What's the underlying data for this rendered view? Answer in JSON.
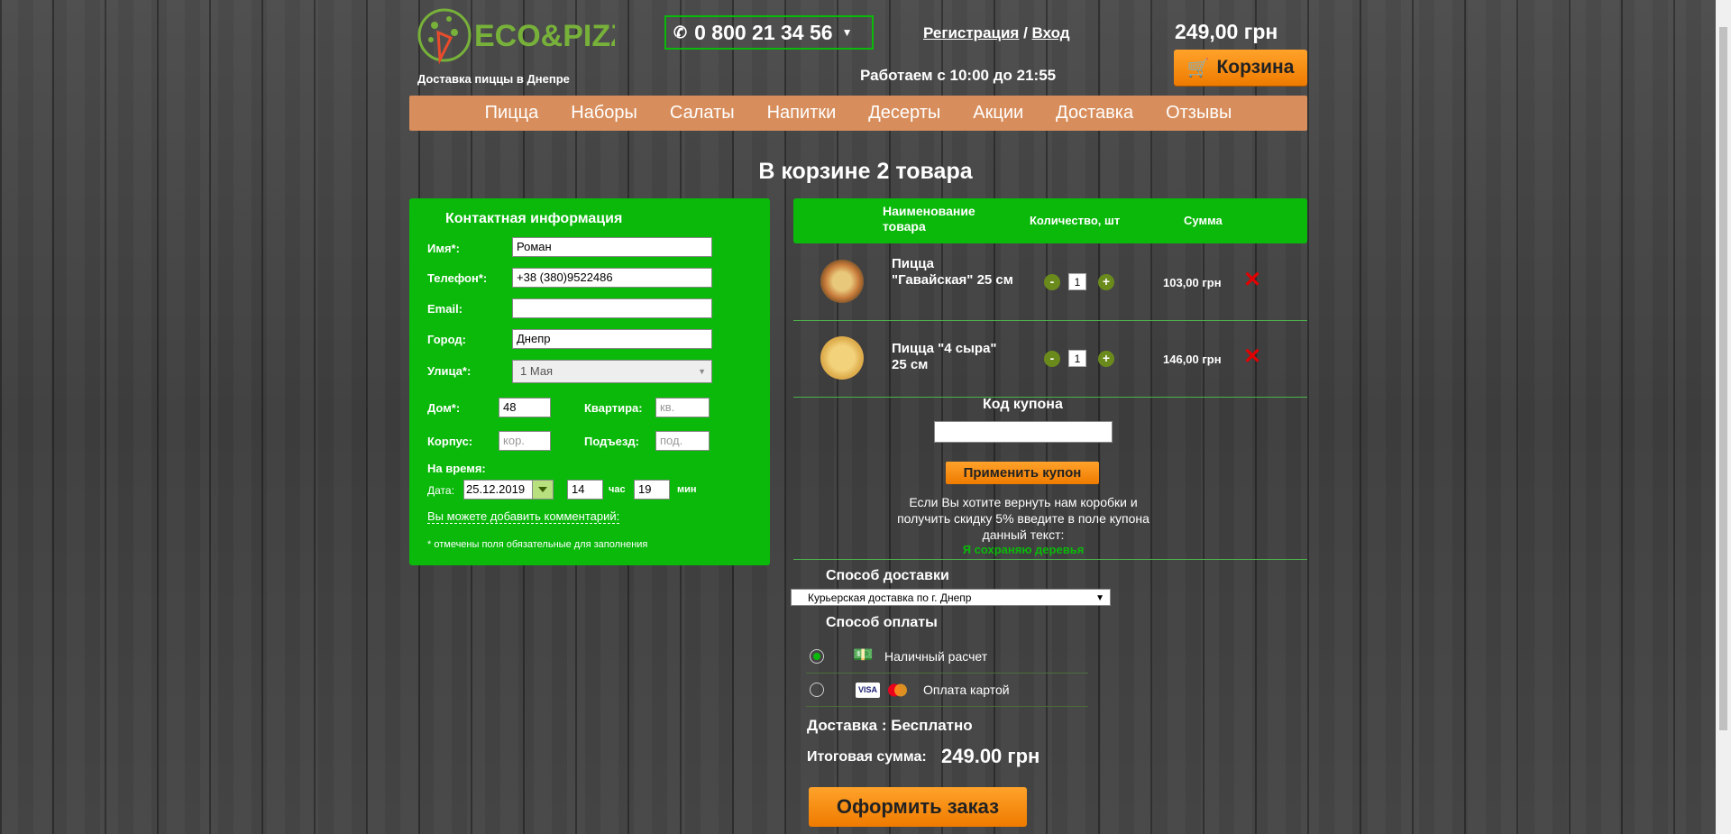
{
  "header": {
    "logo_text": "ECO&PIZZA",
    "tagline": "Доставка пиццы в Днепре",
    "phone": "0 800 21 34 56",
    "register": "Регистрация",
    "auth_sep": "/",
    "login": "Вход",
    "hours": "Работаем с 10:00 до 21:55",
    "cart_total": "249,00 грн",
    "cart_label": "Корзина"
  },
  "nav": [
    "Пицца",
    "Наборы",
    "Салаты",
    "Напитки",
    "Десерты",
    "Акции",
    "Доставка",
    "Отзывы"
  ],
  "heading": "В корзине 2 товара",
  "contact": {
    "title": "Контактная информация",
    "name_label": "Имя*:",
    "name_value": "Роман",
    "phone_label": "Телефон*:",
    "phone_value": "+38 (380)9522486",
    "email_label": "Email:",
    "email_value": "",
    "city_label": "Город:",
    "city_value": "Днепр",
    "street_label": "Улица*:",
    "street_value": "1 Мая",
    "house_label": "Дом*:",
    "house_value": "48",
    "flat_label": "Квартира:",
    "flat_placeholder": "кв.",
    "block_label": "Корпус:",
    "block_placeholder": "кор.",
    "entrance_label": "Подъезд:",
    "entrance_placeholder": "под.",
    "time_label": "На время:",
    "date_label": "Дата:",
    "date_value": "25.12.2019",
    "hour_value": "14",
    "hour_label": "час",
    "min_value": "19",
    "min_label": "мин",
    "comment_link": "Вы можете добавить комментарий:",
    "note": "* отмечены поля обязательные для заполнения"
  },
  "cart_table": {
    "col_name": "Наименование товара",
    "col_qty": "Количество, шт",
    "col_sum": "Сумма",
    "items": [
      {
        "name": "Пицца \"Гавайская\" 25 см",
        "qty": "1",
        "sum": "103,00 грн",
        "minus": "-",
        "plus": "+",
        "remove": "✕"
      },
      {
        "name": "Пицца \"4 сыра\" 25 см",
        "qty": "1",
        "sum": "146,00 грн",
        "minus": "-",
        "plus": "+",
        "remove": "✕"
      }
    ]
  },
  "coupon": {
    "title": "Код купона",
    "button": "Применить купон",
    "hint": "Если Вы хотите вернуть нам коробки и получить скидку 5% введите в поле купона данный текст:",
    "code_text": "Я сохраняю деревья"
  },
  "delivery": {
    "title": "Способ доставки",
    "selected": "Курьерская доставка по г. Днепр"
  },
  "payment": {
    "title": "Способ оплаты",
    "options": [
      {
        "label": "Наличный расчет",
        "checked": true,
        "icon": "cash-icon"
      },
      {
        "label": "Оплата картой",
        "checked": false,
        "icon": "card-icon",
        "card_brands": [
          "VISA",
          "mastercard"
        ]
      }
    ]
  },
  "summary": {
    "delivery_text": "Доставка : Бесплатно",
    "total_label": "Итоговая сумма:",
    "total_value": "249.00 грн",
    "order_button": "Оформить заказ"
  },
  "colors": {
    "green": "#0ab90a",
    "orange": "#ef7b00",
    "nav_bg": "#d88e5c",
    "remove": "#e00000"
  }
}
